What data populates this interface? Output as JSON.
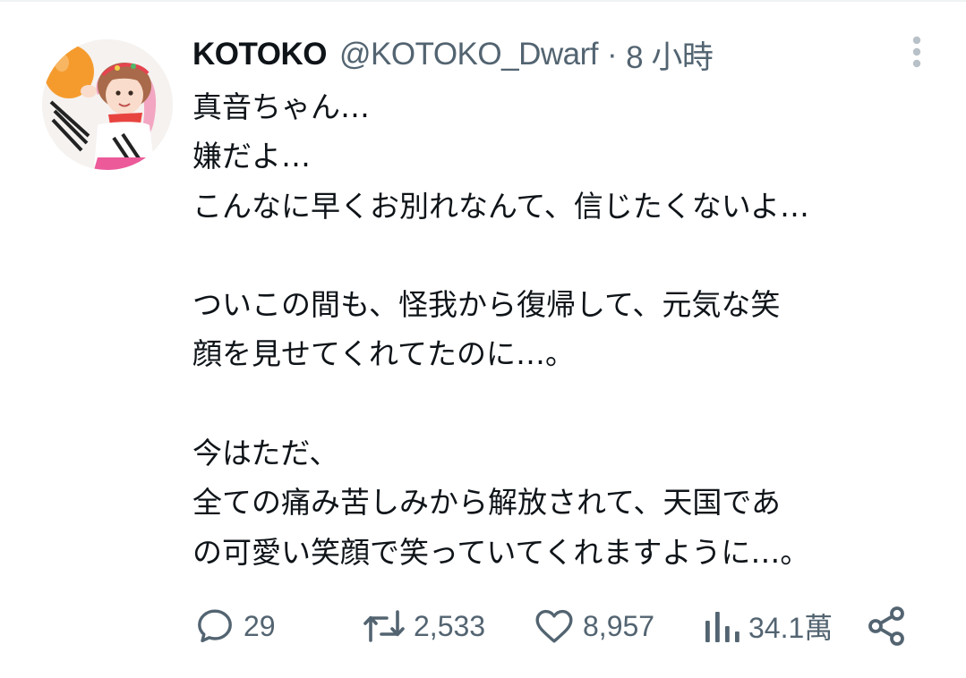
{
  "tweet": {
    "author": {
      "display_name": "KOTOKO",
      "handle": "@KOTOKO_Dwarf",
      "separator": "·",
      "time": "8 小時"
    },
    "avatar_icon": "profile-photo-icon",
    "more_icon": "more-vertical-icon",
    "lines": [
      "真音ちゃん…",
      "嫌だよ…",
      "こんなに早くお別れなんて、信じたくないよ…",
      "",
      "ついこの間も、怪我から復帰して、元気な笑",
      "顔を見せてくれてたのに…。",
      "",
      "今はただ、",
      "全ての痛み苦しみから解放されて、天国であ",
      "の可愛い笑顔で笑っていてくれますように…。"
    ],
    "actions": {
      "reply": {
        "icon": "reply-icon",
        "count": "29"
      },
      "retweet": {
        "icon": "retweet-icon",
        "count": "2,533"
      },
      "like": {
        "icon": "heart-icon",
        "count": "8,957"
      },
      "views": {
        "icon": "views-bar-chart-icon",
        "count": "34.1萬"
      },
      "share": {
        "icon": "share-icon"
      }
    }
  },
  "colors": {
    "primary_text": "#0f1419",
    "secondary_text": "#536471",
    "divider": "#eff3f4"
  }
}
